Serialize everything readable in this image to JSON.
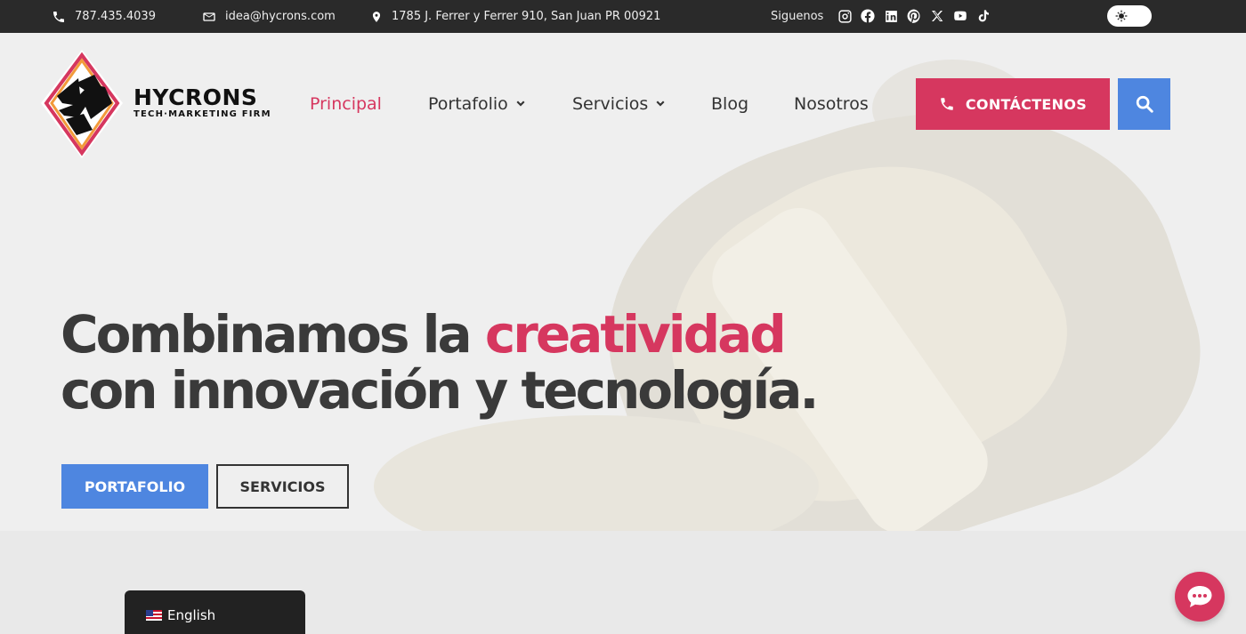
{
  "topbar": {
    "phone": "787.435.4039",
    "email": "idea@hycrons.com",
    "address": "1785 J. Ferrer y Ferrer 910, San Juan PR 00921",
    "follow_label": "Siguenos",
    "socials": [
      "instagram-icon",
      "facebook-icon",
      "linkedin-icon",
      "pinterest-icon",
      "x-icon",
      "youtube-icon",
      "tiktok-icon"
    ]
  },
  "logo": {
    "name": "HYCRONS",
    "tagline": "TECH·MARKETING FIRM"
  },
  "nav": {
    "items": [
      {
        "label": "Principal",
        "active": true
      },
      {
        "label": "Portafolio",
        "dropdown": true
      },
      {
        "label": "Servicios",
        "dropdown": true
      },
      {
        "label": "Blog"
      },
      {
        "label": "Nosotros"
      }
    ],
    "contact_label": "CONTÁCTENOS"
  },
  "hero": {
    "line1_prefix": "Combinamos la ",
    "line1_highlight": "creatividad",
    "line2": "con innovación y tecnología.",
    "primary_button": "PORTAFOLIO",
    "secondary_button": "SERVICIOS"
  },
  "language": {
    "label": "English"
  },
  "colors": {
    "accent": "#d6375f",
    "blue": "#4e86e0",
    "topbar": "#2a2a2a"
  }
}
